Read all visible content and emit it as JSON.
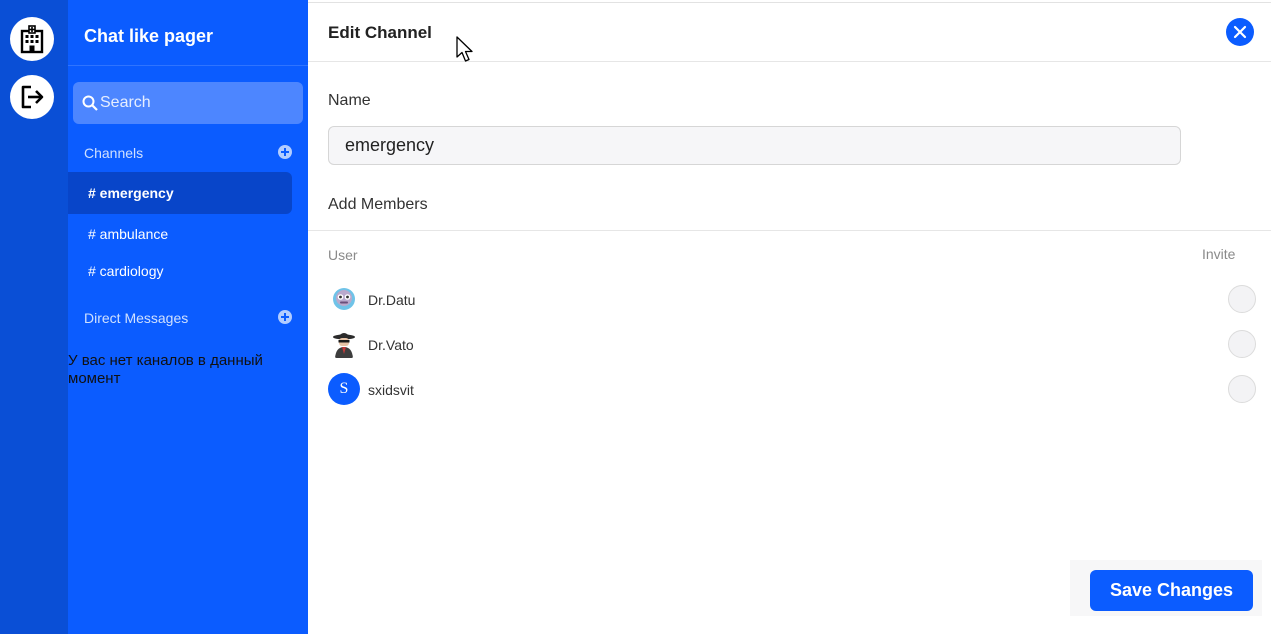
{
  "sidebar": {
    "title": "Chat like pager",
    "search_placeholder": "Search",
    "channels_label": "Channels",
    "channels": [
      {
        "label": "# emergency",
        "active": true
      },
      {
        "label": "# ambulance",
        "active": false
      },
      {
        "label": "# cardiology",
        "active": false
      }
    ],
    "dm_label": "Direct Messages",
    "no_channels_text": "У вас нет каналов в данный момент"
  },
  "panel": {
    "title": "Edit Channel",
    "name_label": "Name",
    "name_value": "emergency",
    "add_members_label": "Add Members",
    "col_user": "User",
    "col_invite": "Invite",
    "users": [
      {
        "name": "Dr.Datu",
        "avatar": "robot-avatar-icon"
      },
      {
        "name": "Dr.Vato",
        "avatar": "spy-avatar-icon"
      },
      {
        "name": "sxidsvit",
        "avatar_letter": "S"
      }
    ],
    "save_label": "Save Changes"
  },
  "icons": {
    "rail_top": "hospital-icon",
    "rail_bottom": "logout-icon",
    "close": "close-icon",
    "search": "search-icon",
    "add": "plus-circle-icon"
  },
  "colors": {
    "accent": "#0b5cff",
    "rail": "#0a4fd6",
    "active_channel": "#0845c9"
  }
}
